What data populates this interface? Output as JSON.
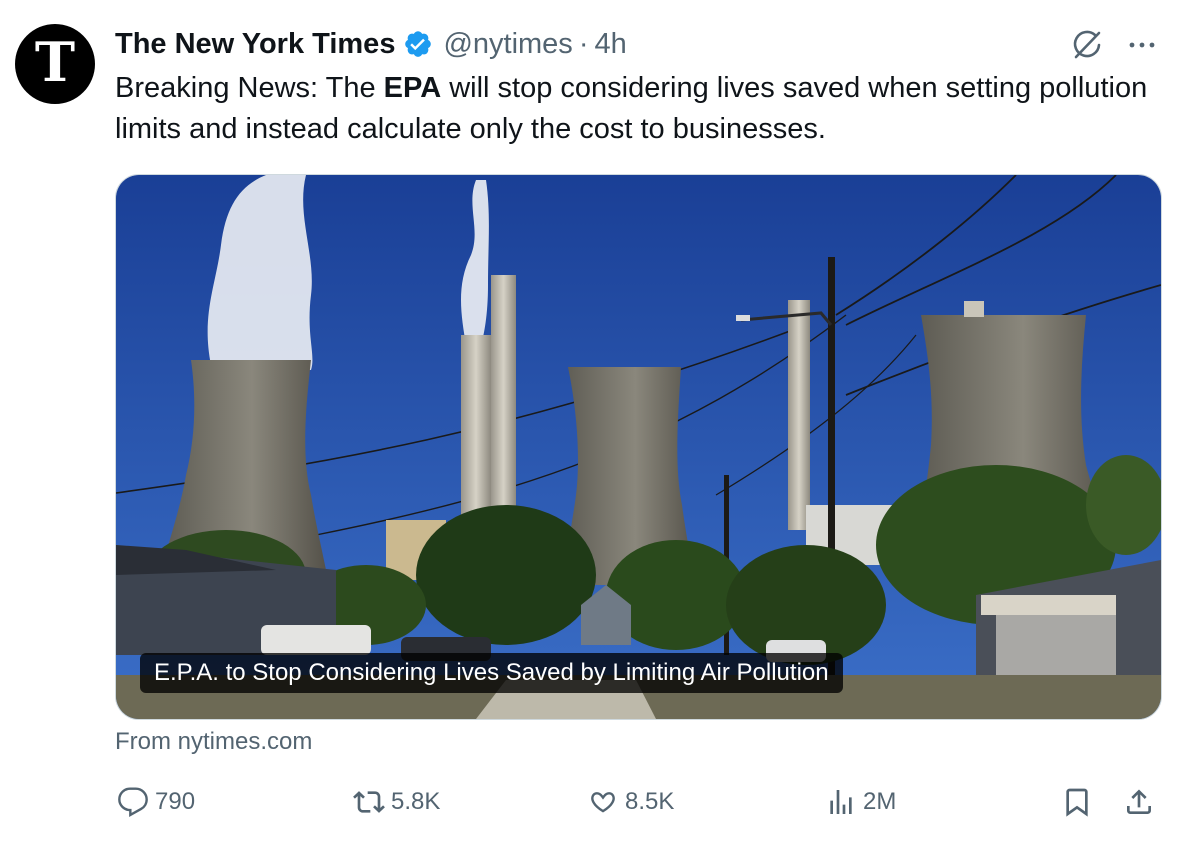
{
  "avatar": {
    "letter": "T"
  },
  "header": {
    "name": "The New York Times",
    "handle": "@nytimes",
    "separator": "·",
    "time": "4h"
  },
  "tweet": {
    "text_before": "Breaking News: The ",
    "text_bold": "EPA",
    "text_after": " will stop considering lives saved when setting pollution limits and instead calculate only the cost to businesses."
  },
  "media": {
    "caption": "E.P.A. to Stop Considering Lives Saved by Limiting Air Pollution"
  },
  "source": "From nytimes.com",
  "actions": {
    "replies": "790",
    "reposts": "5.8K",
    "likes": "8.5K",
    "views": "2M"
  },
  "colors": {
    "verified": "#1d9bf0",
    "secondary_text": "#536471",
    "sky": "#1f4aa8"
  }
}
